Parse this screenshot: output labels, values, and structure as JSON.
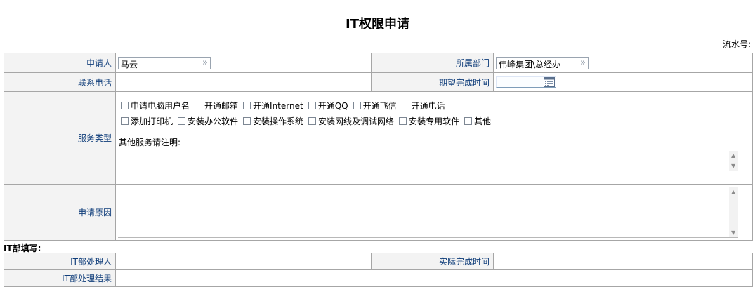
{
  "form": {
    "title": "IT权限申请",
    "serial_label": "流水号:",
    "applicant_label": "申请人",
    "applicant_value": "马云",
    "department_label": "所属部门",
    "department_value": "伟峰集团\\总经办",
    "phone_label": "联系电话",
    "phone_value": "",
    "expected_time_label": "期望完成时间",
    "expected_time_value": "",
    "service_type_label": "服务类型",
    "service_options_row1": [
      "申请电脑用户名",
      "开通邮箱",
      "开通Internet",
      "开通QQ",
      "开通飞信",
      "开通电话"
    ],
    "service_options_row2": [
      "添加打印机",
      "安装办公软件",
      "安装操作系统",
      "安装网线及调试网络",
      "安装专用软件",
      "其他"
    ],
    "other_note_label": "其他服务请注明:",
    "reason_label": "申请原因"
  },
  "it_section": {
    "title": "IT部填写:",
    "handler_label": "IT部处理人",
    "actual_time_label": "实际完成时间",
    "result_label": "IT部处理结果"
  },
  "icons": {
    "lookup_arrow": "double-chevron-right-icon",
    "calendar": "calendar-icon"
  }
}
